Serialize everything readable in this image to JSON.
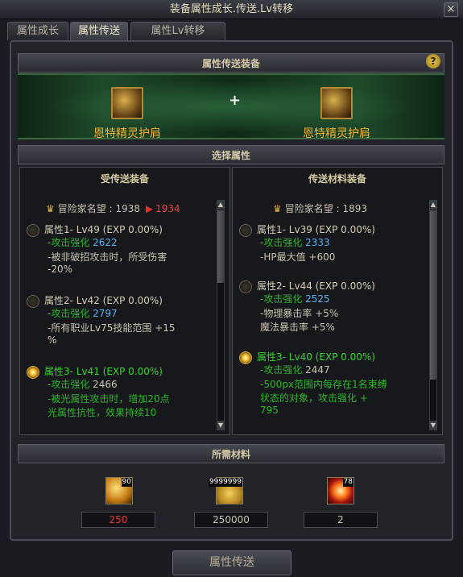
{
  "window": {
    "title": "装备属性成长.传送.Lv转移",
    "close_label": "×"
  },
  "tabs": [
    {
      "label": "属性成长",
      "active": false
    },
    {
      "label": "属性传送",
      "active": true
    },
    {
      "label": "属性Lv转移",
      "active": false
    }
  ],
  "transfer_section": {
    "header": "属性传送装备",
    "help_label": "?",
    "plus": "+",
    "source_item_name": "恩特精灵护肩",
    "target_item_name": "恩特精灵护肩"
  },
  "select_header": "选择属性",
  "left_panel": {
    "title": "受传送装备",
    "fame_label": "冒险家名望",
    "fame_value": ": 1938",
    "fame_arrow": "▶",
    "fame_new": "1934",
    "attrs": [
      {
        "head": "属性1- Lv49 (EXP 0.00%)",
        "selected": false,
        "lines": [
          {
            "prefix": "-攻击强化 ",
            "value": "2622",
            "style": "blue"
          },
          {
            "prefix": "-被非破招攻击时，所受伤害",
            "value": "",
            "style": "plain"
          },
          {
            "prefix": "  -20%",
            "value": "",
            "style": "plain"
          }
        ]
      },
      {
        "head": "属性2- Lv42 (EXP 0.00%)",
        "selected": false,
        "lines": [
          {
            "prefix": "-攻击强化 ",
            "value": "2797",
            "style": "blue"
          },
          {
            "prefix": "-所有职业Lv75技能范围 +15",
            "value": "",
            "style": "plain"
          },
          {
            "prefix": "  %",
            "value": "",
            "style": "plain"
          }
        ]
      },
      {
        "head": "属性3- Lv41 (EXP 0.00%)",
        "selected": true,
        "lines": [
          {
            "prefix": "-攻击强化 ",
            "value": "2466",
            "style": "plain"
          },
          {
            "prefix": "-被光属性攻击时，增加20点",
            "value": "",
            "style": "plain"
          },
          {
            "prefix": "  光属性抗性，效果持续10",
            "value": "",
            "style": "plain"
          }
        ]
      }
    ]
  },
  "right_panel": {
    "title": "传送材料装备",
    "fame_label": "冒险家名望",
    "fame_value": ": 1893",
    "attrs": [
      {
        "head": "属性1- Lv39 (EXP 0.00%)",
        "selected": false,
        "lines": [
          {
            "prefix": "-攻击强化 ",
            "value": "2333",
            "style": "blue"
          },
          {
            "prefix": "-HP最大值 +600",
            "value": "",
            "style": "plain"
          }
        ]
      },
      {
        "head": "属性2- Lv44 (EXP 0.00%)",
        "selected": false,
        "lines": [
          {
            "prefix": "-攻击强化 ",
            "value": "2525",
            "style": "blue"
          },
          {
            "prefix": "-物理暴击率 +5%",
            "value": "",
            "style": "plain"
          },
          {
            "prefix": "  魔法暴击率 +5%",
            "value": "",
            "style": "plain"
          }
        ]
      },
      {
        "head": "属性3- Lv40 (EXP 0.00%)",
        "selected": true,
        "lines": [
          {
            "prefix": "-攻击强化 ",
            "value": "2447",
            "style": "plain"
          },
          {
            "prefix": "-500px范围内每存在1名束缚",
            "value": "",
            "style": "plain"
          },
          {
            "prefix": "  状态的对象，攻击强化 +",
            "value": "",
            "style": "plain"
          },
          {
            "prefix": "  795",
            "value": "",
            "style": "plain"
          }
        ]
      }
    ]
  },
  "materials": {
    "header": "所需材料",
    "items": [
      {
        "icon": "gold-card-icon",
        "badge": "90",
        "required": "250",
        "required_color": "#e23b3b"
      },
      {
        "icon": "gold-coins-icon",
        "badge": "9999999",
        "required": "250000",
        "required_color": "#c8c2ae"
      },
      {
        "icon": "fire-burst-icon",
        "badge": "78",
        "required": "2",
        "required_color": "#c8c2ae"
      }
    ]
  },
  "action_button": "属性传送"
}
